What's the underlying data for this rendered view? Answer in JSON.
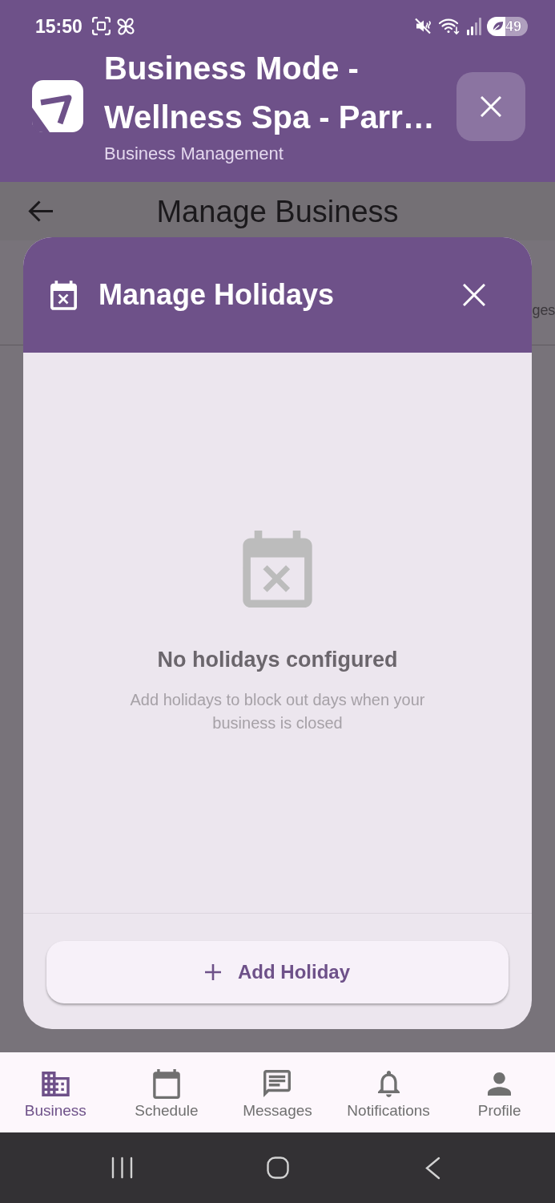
{
  "status_bar": {
    "time": "15:50",
    "battery": "49"
  },
  "app_header": {
    "title": "Business Mode - Wellness Spa - Parr…",
    "subtitle": "Business Management"
  },
  "page": {
    "title": "Manage Business",
    "tabs": [
      {
        "label": "ges"
      }
    ]
  },
  "dialog": {
    "title": "Manage Holidays",
    "empty_state": {
      "title": "No holidays configured",
      "message": "Add holidays to block out days when your business is closed"
    },
    "add_button": {
      "label": "Add Holiday"
    }
  },
  "bottom_nav": [
    {
      "label": "Business",
      "selected": true
    },
    {
      "label": "Schedule",
      "selected": false
    },
    {
      "label": "Messages",
      "selected": false
    },
    {
      "label": "Notifications",
      "selected": false
    },
    {
      "label": "Profile",
      "selected": false
    }
  ]
}
